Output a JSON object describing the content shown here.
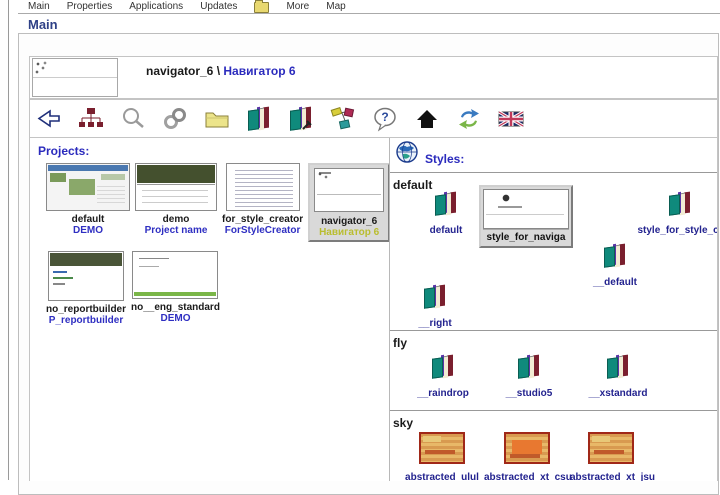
{
  "menubar": {
    "items": [
      "Main",
      "Properties",
      "Applications",
      "Updates",
      "More",
      "Map"
    ]
  },
  "page": {
    "heading": "Main"
  },
  "titlebar": {
    "project_name": "navigator_6",
    "separator": "\\",
    "project_alt_name": "Навигатор 6"
  },
  "toolbar": {
    "icons": [
      "back-arrow",
      "sitemap",
      "search",
      "links",
      "folder",
      "styles-books",
      "styles-tools",
      "style-creator",
      "help",
      "home",
      "refresh",
      "uk-flag"
    ]
  },
  "projects": {
    "label": "Projects:",
    "items": [
      {
        "name": "default",
        "caption": "DEMO",
        "selected": false
      },
      {
        "name": "demo",
        "caption": "Project name",
        "selected": false
      },
      {
        "name": "for_style_creator",
        "caption": "ForStyleCreator",
        "selected": false
      },
      {
        "name": "navigator_6",
        "caption": "Навигатор 6",
        "selected": true
      },
      {
        "name": "no_reportbuilder",
        "caption": "P_reportbuilder",
        "selected": false
      },
      {
        "name": "no__eng_standard",
        "caption": "DEMO",
        "selected": false
      }
    ]
  },
  "styles": {
    "label": "Styles:",
    "groups": [
      {
        "name": "default",
        "items": [
          {
            "name": "default",
            "selected": false
          },
          {
            "name": "style_for_naviga",
            "selected": true
          },
          {
            "name": "style_for_style_cr",
            "selected": false
          },
          {
            "name": "__default",
            "selected": false
          },
          {
            "name": "__right",
            "selected": false
          }
        ]
      },
      {
        "name": "fly",
        "items": [
          {
            "name": "__raindrop",
            "selected": false
          },
          {
            "name": "__studio5",
            "selected": false
          },
          {
            "name": "__xstandard",
            "selected": false
          }
        ]
      },
      {
        "name": "sky",
        "items": [
          {
            "name": "abstracted_ulul",
            "selected": false
          },
          {
            "name": "abstracted_xt_csu",
            "selected": false
          },
          {
            "name": "abstracted_xt_jsu",
            "selected": false
          }
        ]
      }
    ]
  },
  "colors": {
    "accent_blue": "#2b2bbd",
    "heading_navy": "#2f4187",
    "caption_blue": "#2f2fc2",
    "selected_caption_yellow": "#b9bd2e"
  }
}
